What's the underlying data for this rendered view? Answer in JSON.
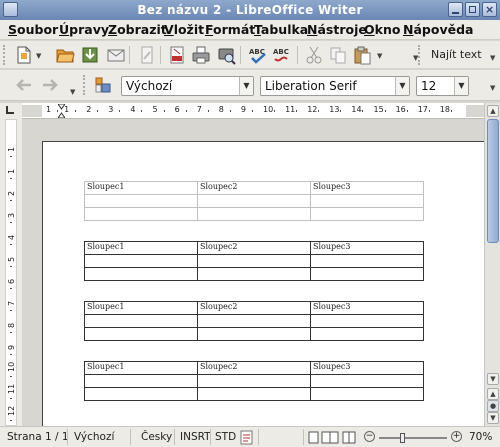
{
  "window": {
    "title": "Bez názvu 2 - LibreOffice Writer"
  },
  "menu": [
    "Soubor",
    "Úpravy",
    "Zobrazit",
    "Vložit",
    "Formát",
    "Tabulka",
    "Nástroje",
    "Okno",
    "Nápověda"
  ],
  "toolbar": {
    "find_label": "Najít text"
  },
  "format": {
    "style": "Výchozí",
    "font": "Liberation Serif",
    "size": "12"
  },
  "ruler": {
    "h_ticks": [
      "1",
      "1",
      "2",
      "3",
      "4",
      "5",
      "6",
      "7",
      "8",
      "9",
      "10",
      "11",
      "12",
      "13",
      "14",
      "15",
      "16",
      "17",
      "18"
    ],
    "v_ticks": [
      "1",
      "1",
      "2",
      "3",
      "4",
      "5",
      "6",
      "7",
      "8",
      "9",
      "10",
      "11",
      "12"
    ]
  },
  "tables": [
    {
      "style": "light",
      "headers": [
        "Sloupec1",
        "Sloupec2",
        "Sloupec3"
      ]
    },
    {
      "style": "dark",
      "headers": [
        "Sloupec1",
        "Sloupec2",
        "Sloupec3"
      ]
    },
    {
      "style": "dark",
      "headers": [
        "Sloupec1",
        "Sloupec2",
        "Sloupec3"
      ]
    },
    {
      "style": "dark",
      "headers": [
        "Sloupec1",
        "Sloupec2",
        "Sloupec3"
      ]
    }
  ],
  "status": {
    "page": "Strana 1 / 1",
    "style": "Výchozí",
    "language": "Česky",
    "insert_mode": "INSRT",
    "selection_mode": "STD",
    "zoom": "70%",
    "zoom_level": 0.35
  }
}
